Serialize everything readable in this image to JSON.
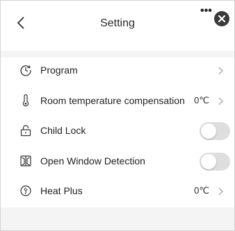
{
  "header": {
    "title": "Setting",
    "more_label": "•••"
  },
  "rows": [
    {
      "label": "Program",
      "value": "",
      "control": "chevron",
      "icon": "clock-icon"
    },
    {
      "label": "Room temperature compensation",
      "value": "0℃",
      "control": "chevron",
      "icon": "thermometer-icon"
    },
    {
      "label": "Child Lock",
      "value": "",
      "control": "toggle",
      "toggle_on": false,
      "icon": "lock-icon"
    },
    {
      "label": "Open Window Detection",
      "value": "",
      "control": "toggle",
      "toggle_on": false,
      "icon": "window-icon"
    },
    {
      "label": "Heat Plus",
      "value": "0℃",
      "control": "chevron",
      "icon": "heat-plus-icon"
    }
  ],
  "colors": {
    "background": "#f4f4f4",
    "card": "#ffffff",
    "toggle_off": "#dedede",
    "close_button": "#3a3a3a"
  }
}
